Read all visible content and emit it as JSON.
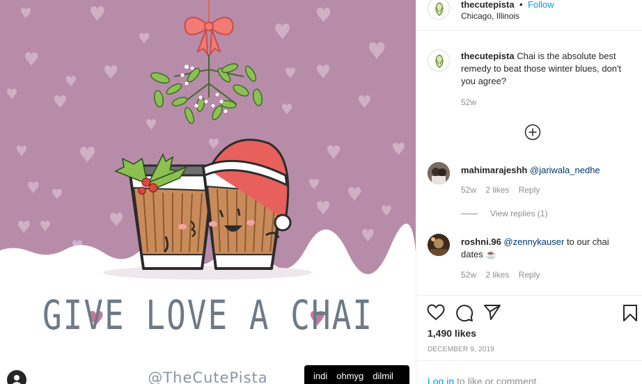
{
  "header": {
    "username": "thecutepista",
    "separator": "•",
    "follow_label": "Follow",
    "location": "Chicago, Illinois"
  },
  "caption": {
    "username": "thecutepista",
    "text": "Chai is the absolute best remedy to beat those winter blues, don't you agree?",
    "time": "52w"
  },
  "load_more_icon": "plus-circle-icon",
  "comments": [
    {
      "username": "mahimarajeshh",
      "mention": "@jariwala_nedhe",
      "text": "",
      "time": "52w",
      "likes": "2 likes",
      "reply_label": "Reply",
      "view_replies": "View replies (1)"
    },
    {
      "username": "roshni.96",
      "mention": "@zennykauser",
      "text": " to our chai dates ☕",
      "time": "52w",
      "likes": "2 likes",
      "reply_label": "Reply"
    }
  ],
  "actions": {
    "icons": [
      "heart-icon",
      "comment-icon",
      "share-icon",
      "bookmark-icon"
    ],
    "likes": "1,490 likes",
    "date": "DECEMBER 9, 2019"
  },
  "login_prompt": {
    "link": "Log in",
    "rest": " to like or comment."
  },
  "image": {
    "title": "GIVE LOVE A CHAI",
    "handle": "@TheCutePista",
    "tags": [
      "indi",
      "ohmyg",
      "dilmil"
    ]
  },
  "colors": {
    "background_purple": "#b78ca9",
    "accent_blue": "#0095f6",
    "bow_red": "#e0625e",
    "leaf_green": "#7fae4a"
  }
}
